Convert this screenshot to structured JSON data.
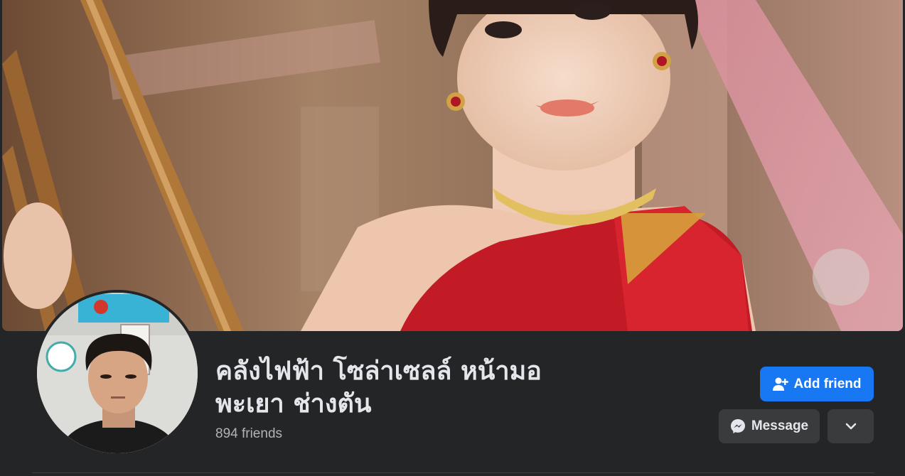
{
  "profile": {
    "name_line1": "คลังไฟฟ้า โซล่าเซลล์ หน้ามอ",
    "name_line2": "พะเยา ช่างตัน",
    "friends_count": "894 friends"
  },
  "actions": {
    "add_friend_label": "Add friend",
    "message_label": "Message"
  },
  "icons": {
    "add_friend": "person-plus-icon",
    "message": "messenger-icon",
    "more": "chevron-down-icon"
  },
  "colors": {
    "background": "#242526",
    "primary_button": "#1877f2",
    "secondary_button": "#3a3b3c",
    "name_text": "#e4e6eb",
    "secondary_text": "#b0b3b8"
  }
}
